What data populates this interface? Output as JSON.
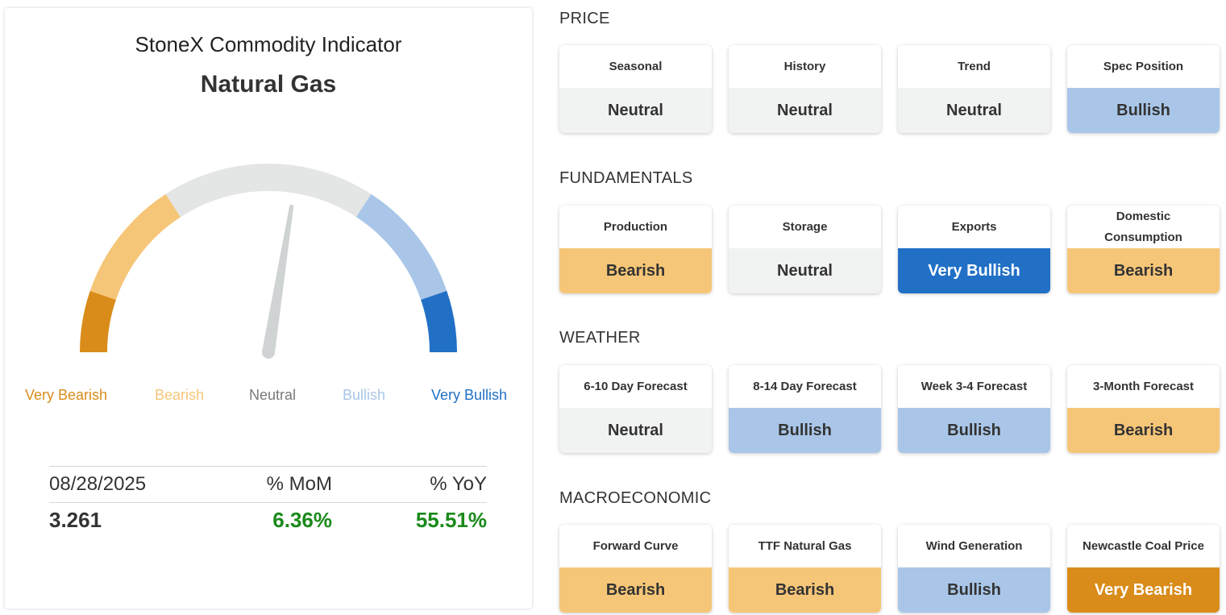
{
  "indicator": {
    "title": "StoneX Commodity Indicator",
    "commodity": "Natural Gas",
    "gauge_position": 0.55,
    "scale_labels": [
      "Very Bearish",
      "Bearish",
      "Neutral",
      "Bullish",
      "Very Bullish"
    ],
    "date": "08/28/2025",
    "mom_header": "% MoM",
    "yoy_header": "% YoY",
    "price": "3.261",
    "mom_value": "6.36%",
    "yoy_value": "55.51%"
  },
  "colors": {
    "very_bearish": "#d98c1a",
    "bearish": "#f6c678",
    "neutral": "#f1f2f2",
    "bullish": "#a9c6e8",
    "very_bullish": "#2170c6",
    "gauge_track": "#e4e6e5",
    "needle": "#d0d3d3",
    "positive": "#1a8a1a"
  },
  "sections": [
    {
      "title": "PRICE",
      "tiles": [
        {
          "label": "Seasonal",
          "value": "Neutral"
        },
        {
          "label": "History",
          "value": "Neutral"
        },
        {
          "label": "Trend",
          "value": "Neutral"
        },
        {
          "label": "Spec Position",
          "value": "Bullish"
        }
      ]
    },
    {
      "title": "FUNDAMENTALS",
      "tiles": [
        {
          "label": "Production",
          "value": "Bearish"
        },
        {
          "label": "Storage",
          "value": "Neutral"
        },
        {
          "label": "Exports",
          "value": "Very Bullish"
        },
        {
          "label": "Domestic Consumption",
          "value": "Bearish"
        }
      ]
    },
    {
      "title": "WEATHER",
      "tiles": [
        {
          "label": "6-10 Day Forecast",
          "value": "Neutral"
        },
        {
          "label": "8-14 Day Forecast",
          "value": "Bullish"
        },
        {
          "label": "Week 3-4 Forecast",
          "value": "Bullish"
        },
        {
          "label": "3-Month Forecast",
          "value": "Bearish"
        }
      ]
    },
    {
      "title": "MACROECONOMIC",
      "tiles": [
        {
          "label": "Forward Curve",
          "value": "Bearish"
        },
        {
          "label": "TTF Natural Gas",
          "value": "Bearish"
        },
        {
          "label": "Wind Generation",
          "value": "Bullish"
        },
        {
          "label": "Newcastle Coal Price",
          "value": "Very Bearish"
        }
      ]
    }
  ]
}
